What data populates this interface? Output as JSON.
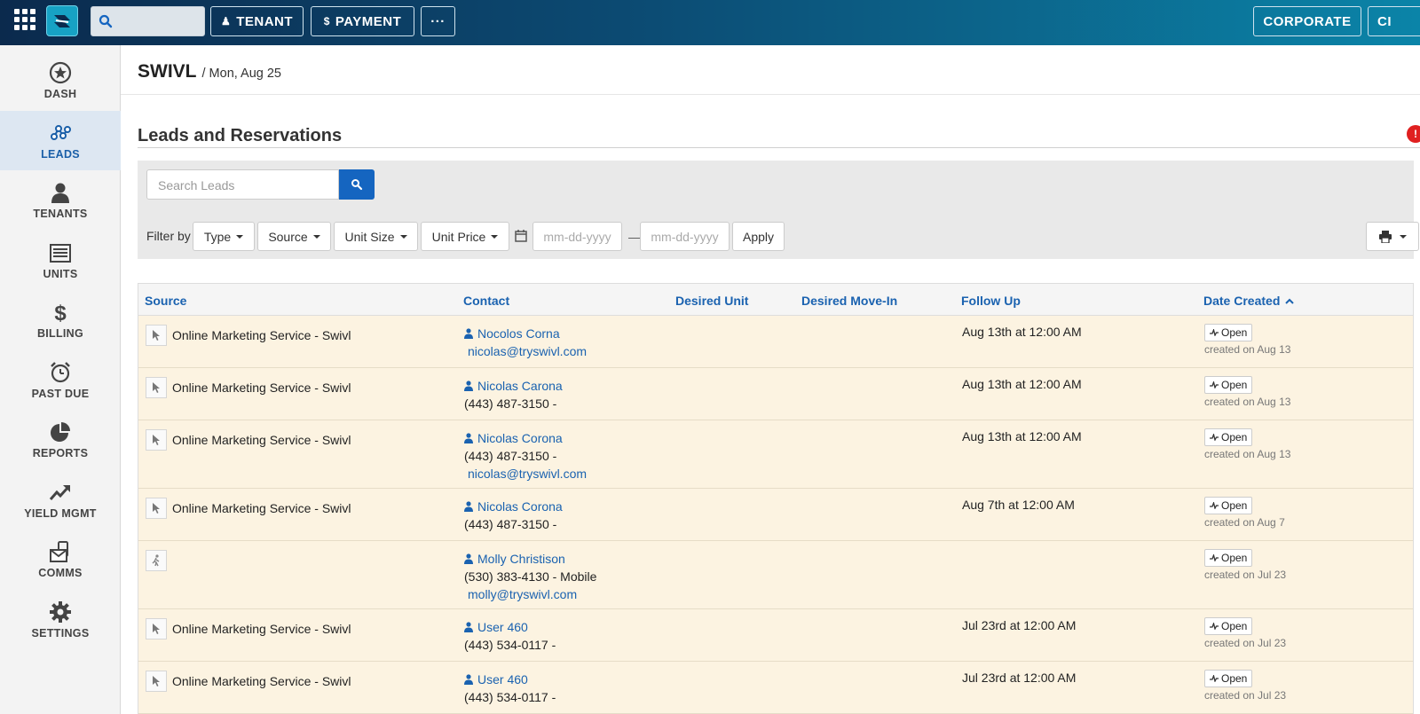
{
  "topbar": {
    "tenant_label": "TENANT",
    "payment_label": "PAYMENT",
    "more_label": "···",
    "corporate_label": "CORPORATE",
    "cut_label": "CI"
  },
  "sidebar": {
    "items": [
      {
        "label": "DASH",
        "icon": "star-icon"
      },
      {
        "label": "LEADS",
        "icon": "network-icon",
        "active": true
      },
      {
        "label": "TENANTS",
        "icon": "person-icon"
      },
      {
        "label": "UNITS",
        "icon": "units-icon"
      },
      {
        "label": "BILLING",
        "icon": "dollar-icon"
      },
      {
        "label": "PAST DUE",
        "icon": "alarm-clock-icon"
      },
      {
        "label": "REPORTS",
        "icon": "pie-chart-icon"
      },
      {
        "label": "YIELD MGMT",
        "icon": "trend-up-icon"
      },
      {
        "label": "COMMS",
        "icon": "envelope-phone-icon"
      },
      {
        "label": "SETTINGS",
        "icon": "gear-icon"
      }
    ]
  },
  "header": {
    "brand": "SWIVL",
    "date": "/ Mon, Aug 25"
  },
  "section": {
    "title": "Leads and Reservations",
    "notif_count": "!"
  },
  "filters": {
    "search_placeholder": "Search Leads",
    "filter_by": "Filter by",
    "type": "Type",
    "source": "Source",
    "unit_size": "Unit Size",
    "unit_price": "Unit Price",
    "date_from_placeholder": "mm-dd-yyyy",
    "date_sep": "—",
    "date_to_placeholder": "mm-dd-yyyy",
    "apply": "Apply"
  },
  "table": {
    "columns": {
      "source": "Source",
      "contact": "Contact",
      "desired_unit": "Desired Unit",
      "desired_move_in": "Desired Move-In",
      "follow_up": "Follow Up",
      "date_created": "Date Created"
    },
    "rows": [
      {
        "source_icon": "cursor-icon",
        "source": "Online Marketing Service - Swivl",
        "name": "Nocolos Corna",
        "lines": [],
        "email": "nicolas@tryswivl.com",
        "follow_up": "Aug 13th at 12:00 AM",
        "status": "Open",
        "created": "created on Aug 13"
      },
      {
        "source_icon": "cursor-icon",
        "source": "Online Marketing Service - Swivl",
        "name": "Nicolas Carona",
        "lines": [
          "(443) 487-3150 -"
        ],
        "email": "",
        "follow_up": "Aug 13th at 12:00 AM",
        "status": "Open",
        "created": "created on Aug 13"
      },
      {
        "source_icon": "cursor-icon",
        "source": "Online Marketing Service - Swivl",
        "name": "Nicolas Corona",
        "lines": [
          "(443) 487-3150 -"
        ],
        "email": "nicolas@tryswivl.com",
        "follow_up": "Aug 13th at 12:00 AM",
        "status": "Open",
        "created": "created on Aug 13"
      },
      {
        "source_icon": "cursor-icon",
        "source": "Online Marketing Service - Swivl",
        "name": "Nicolas Corona",
        "lines": [
          "(443) 487-3150 -"
        ],
        "email": "",
        "follow_up": "Aug 7th at 12:00 AM",
        "status": "Open",
        "created": "created on Aug 7"
      },
      {
        "source_icon": "walk-in-icon",
        "source": "",
        "name": "Molly Christison",
        "lines": [
          "(530) 383-4130 - Mobile"
        ],
        "email": "molly@tryswivl.com",
        "follow_up": "",
        "status": "Open",
        "created": "created on Jul 23"
      },
      {
        "source_icon": "cursor-icon",
        "source": "Online Marketing Service - Swivl",
        "name": "User 460",
        "lines": [
          "(443) 534-0117 -"
        ],
        "email": "",
        "follow_up": "Jul 23rd at 12:00 AM",
        "status": "Open",
        "created": "created on Jul 23"
      },
      {
        "source_icon": "cursor-icon",
        "source": "Online Marketing Service - Swivl",
        "name": "User 460",
        "lines": [
          "(443) 534-0117 -"
        ],
        "email": "",
        "follow_up": "Jul 23rd at 12:00 AM",
        "status": "Open",
        "created": "created on Jul 23"
      }
    ]
  }
}
